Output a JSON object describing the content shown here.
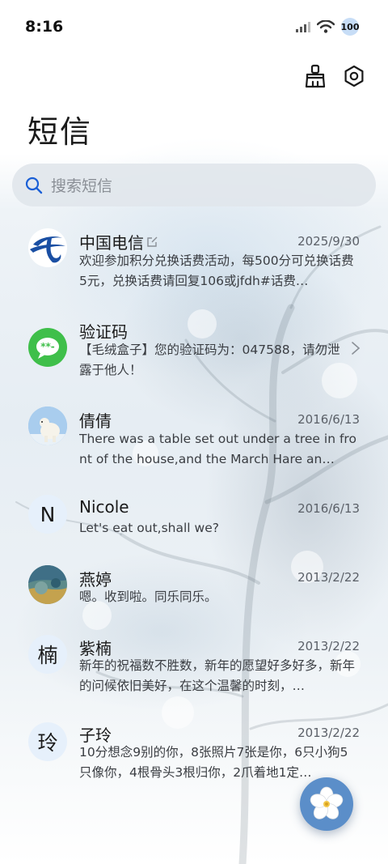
{
  "status_bar": {
    "time": "8:16",
    "battery": "100"
  },
  "header": {
    "title": "短信"
  },
  "search": {
    "placeholder": "搜索短信"
  },
  "messages": [
    {
      "sender": "中国电信",
      "date": "2025/9/30",
      "preview": "欢迎参加积分兑换话费活动，每500分可兑换话费5元，兑换话费请回复106或jfdh#话费…",
      "avatar_icon": "china-telecom-logo-icon"
    },
    {
      "sender": "验证码",
      "date": "",
      "preview": "【毛绒盒子】您的验证码为：047588，请勿泄露于他人！",
      "avatar_icon": "message-bubble-icon"
    },
    {
      "sender": "倩倩",
      "date": "2016/6/13",
      "preview": "There was a table set out under a tree in front of the house,and the March Hare an…",
      "avatar_icon": "polar-bear-photo-icon"
    },
    {
      "sender": "Nicole",
      "date": "2016/6/13",
      "preview": "Let's eat out,shall we?",
      "avatar_letter": "N"
    },
    {
      "sender": "燕婷",
      "date": "2013/2/22",
      "preview": "嗯。收到啦。同乐同乐。",
      "avatar_icon": "painting-photo-icon"
    },
    {
      "sender": "紫楠",
      "date": "2013/2/22",
      "preview": "新年的祝福数不胜数，新年的愿望好多好多，新年的问候依旧美好，在这个温馨的时刻，…",
      "avatar_letter": "楠"
    },
    {
      "sender": "子玲",
      "date": "2013/2/22",
      "preview": "10分想念9别的你，8张照片7张是你，6只小狗5只像你，4根骨头3根归你，2爪着地1定…",
      "avatar_letter": "玲"
    }
  ],
  "colors": {
    "accent": "#1a5fd6",
    "fab": "#5b8ec9",
    "letter_avatar_bg": "#e6f0fb",
    "verify_green": "#3fbf4a"
  }
}
